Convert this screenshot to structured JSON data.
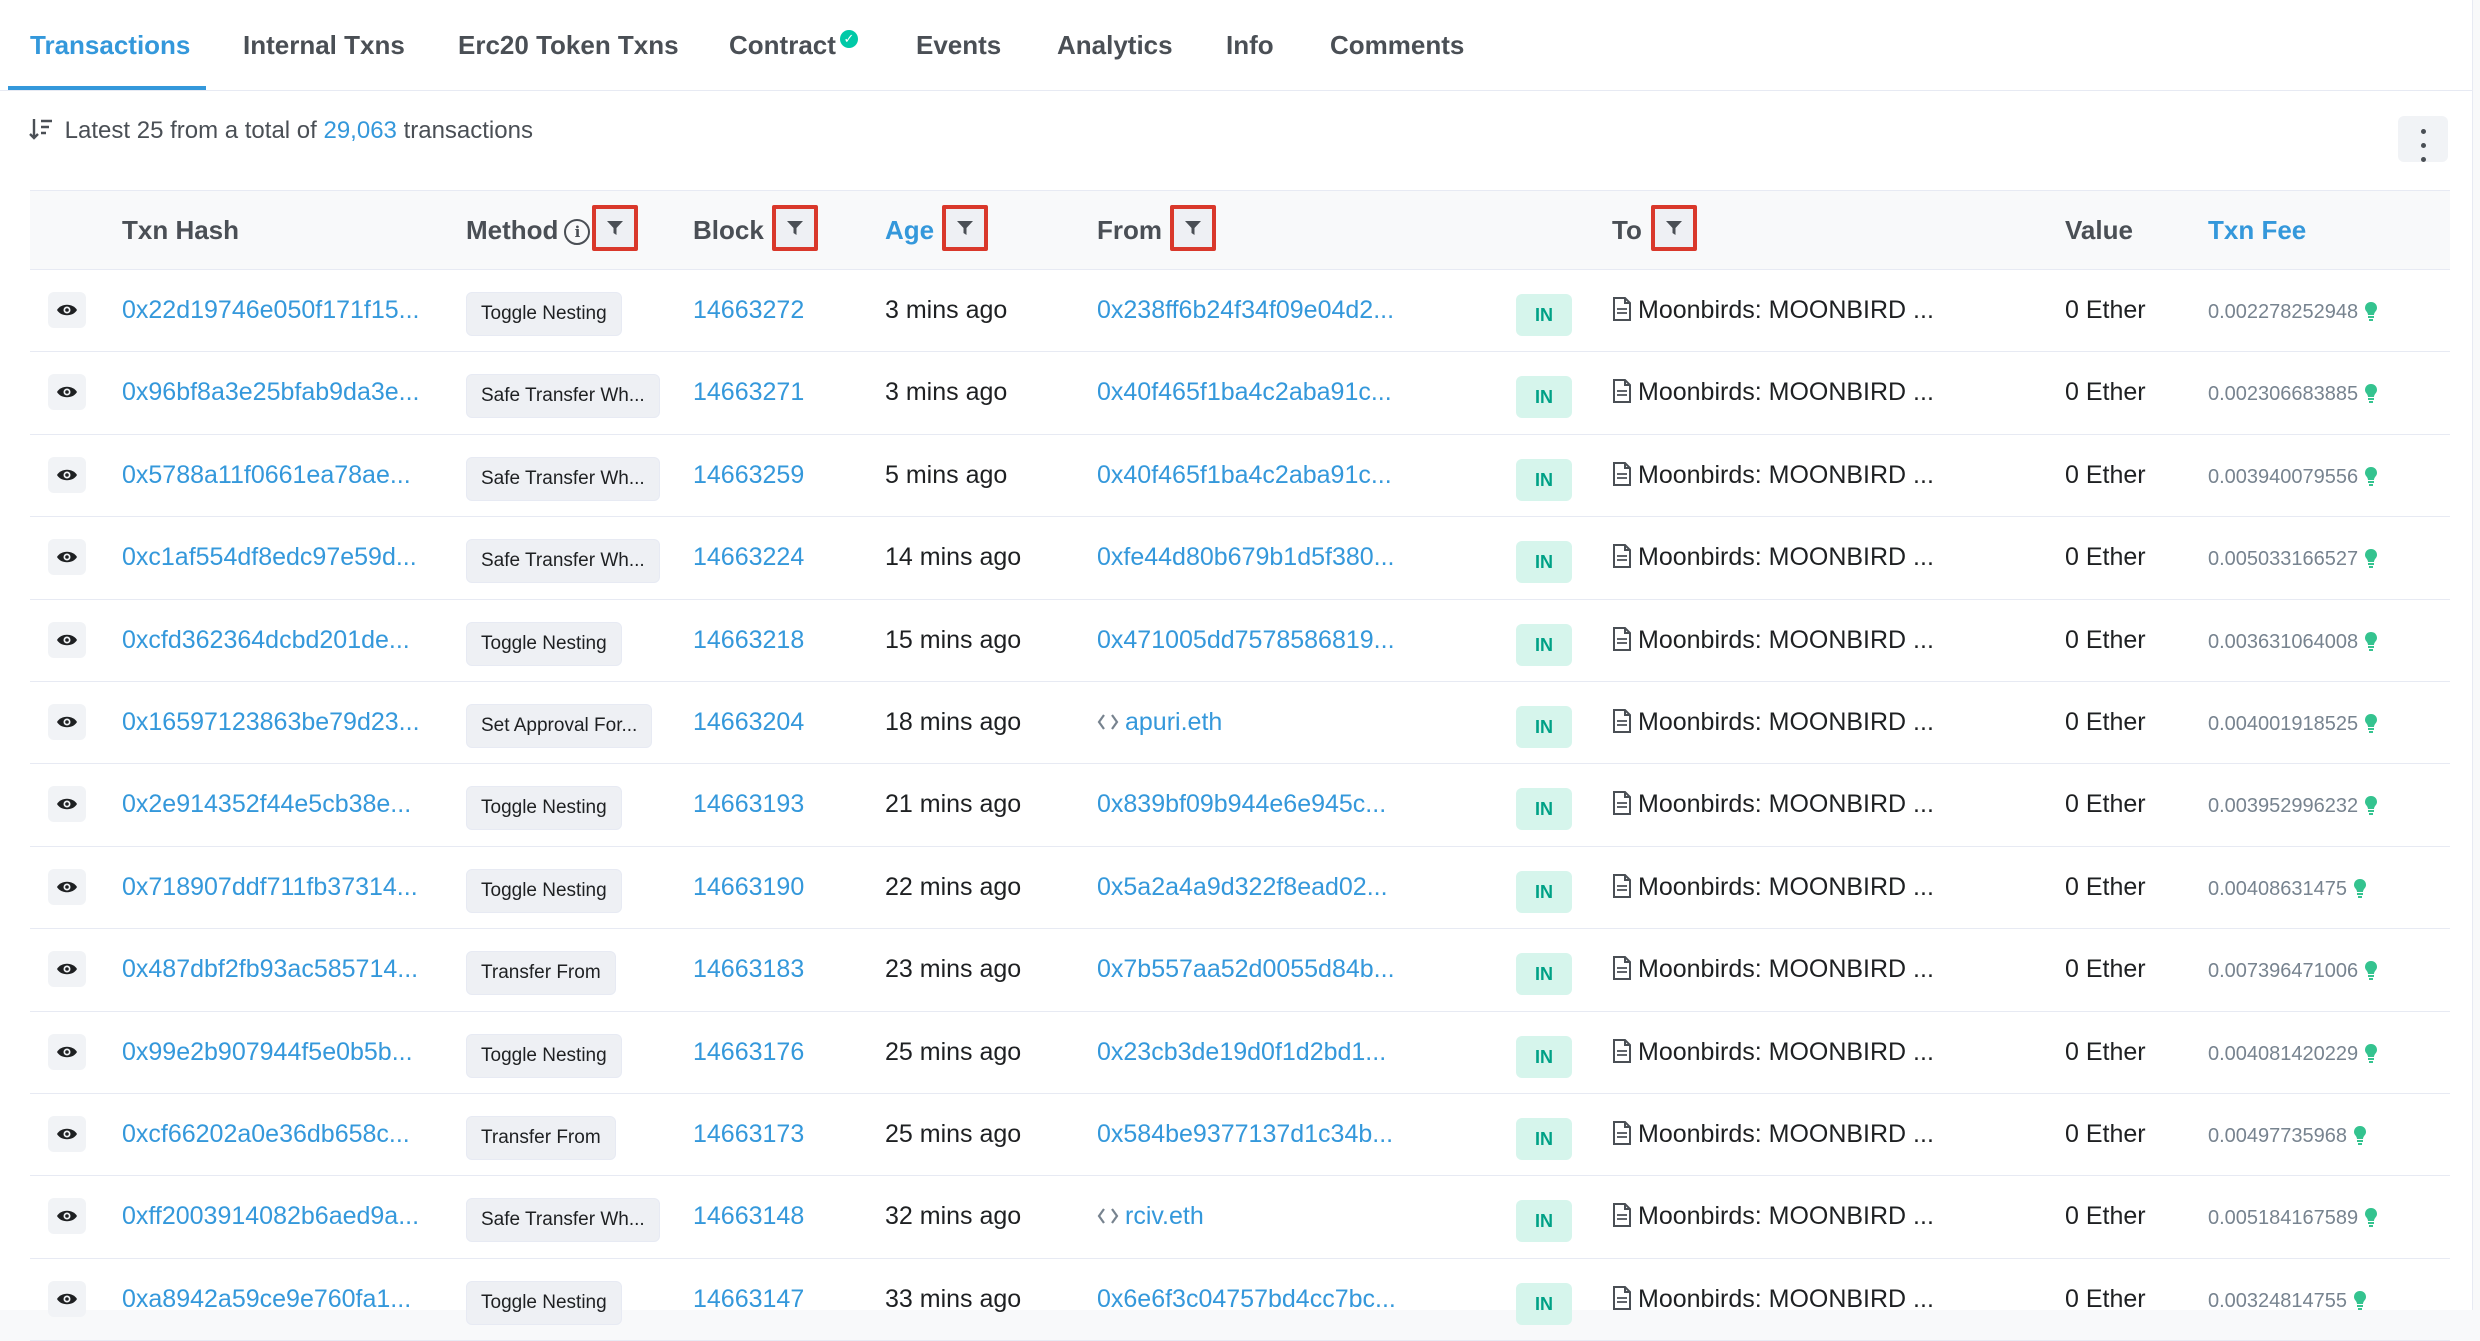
{
  "tabs": [
    {
      "label": "Transactions",
      "active": true
    },
    {
      "label": "Internal Txns"
    },
    {
      "label": "Erc20 Token Txns"
    },
    {
      "label": "Contract",
      "verified": true
    },
    {
      "label": "Events"
    },
    {
      "label": "Analytics"
    },
    {
      "label": "Info"
    },
    {
      "label": "Comments"
    }
  ],
  "summary": {
    "prefix": "Latest 25 from a total of",
    "count": "29,063",
    "suffix": "transactions"
  },
  "columns": {
    "txn_hash": "Txn Hash",
    "method": "Method",
    "block": "Block",
    "age": "Age",
    "from": "From",
    "to": "To",
    "value": "Value",
    "txn_fee": "Txn Fee"
  },
  "colors": {
    "accent": "#3498db",
    "in_badge_bg": "#d6f5ec",
    "in_badge_text": "#00a186",
    "filter_highlight": "#d9382b"
  },
  "rows": [
    {
      "hash": "0x22d19746e050f171f15...",
      "method": "Toggle Nesting",
      "block": "14663272",
      "age": "3 mins ago",
      "from": "0x238ff6b24f34f09e04d2...",
      "from_ens": false,
      "direction": "IN",
      "to": "Moonbirds: MOONBIRD ...",
      "value": "0 Ether",
      "fee": "0.002278252948"
    },
    {
      "hash": "0x96bf8a3e25bfab9da3e...",
      "method": "Safe Transfer Wh...",
      "block": "14663271",
      "age": "3 mins ago",
      "from": "0x40f465f1ba4c2aba91c...",
      "from_ens": false,
      "direction": "IN",
      "to": "Moonbirds: MOONBIRD ...",
      "value": "0 Ether",
      "fee": "0.002306683885"
    },
    {
      "hash": "0x5788a11f0661ea78ae...",
      "method": "Safe Transfer Wh...",
      "block": "14663259",
      "age": "5 mins ago",
      "from": "0x40f465f1ba4c2aba91c...",
      "from_ens": false,
      "direction": "IN",
      "to": "Moonbirds: MOONBIRD ...",
      "value": "0 Ether",
      "fee": "0.003940079556"
    },
    {
      "hash": "0xc1af554df8edc97e59d...",
      "method": "Safe Transfer Wh...",
      "block": "14663224",
      "age": "14 mins ago",
      "from": "0xfe44d80b679b1d5f380...",
      "from_ens": false,
      "direction": "IN",
      "to": "Moonbirds: MOONBIRD ...",
      "value": "0 Ether",
      "fee": "0.005033166527"
    },
    {
      "hash": "0xcfd362364dcbd201de...",
      "method": "Toggle Nesting",
      "block": "14663218",
      "age": "15 mins ago",
      "from": "0x471005dd7578586819...",
      "from_ens": false,
      "direction": "IN",
      "to": "Moonbirds: MOONBIRD ...",
      "value": "0 Ether",
      "fee": "0.003631064008"
    },
    {
      "hash": "0x16597123863be79d23...",
      "method": "Set Approval For...",
      "block": "14663204",
      "age": "18 mins ago",
      "from": "apuri.eth",
      "from_ens": true,
      "direction": "IN",
      "to": "Moonbirds: MOONBIRD ...",
      "value": "0 Ether",
      "fee": "0.004001918525"
    },
    {
      "hash": "0x2e914352f44e5cb38e...",
      "method": "Toggle Nesting",
      "block": "14663193",
      "age": "21 mins ago",
      "from": "0x839bf09b944e6e945c...",
      "from_ens": false,
      "direction": "IN",
      "to": "Moonbirds: MOONBIRD ...",
      "value": "0 Ether",
      "fee": "0.003952996232"
    },
    {
      "hash": "0x718907ddf711fb37314...",
      "method": "Toggle Nesting",
      "block": "14663190",
      "age": "22 mins ago",
      "from": "0x5a2a4a9d322f8ead02...",
      "from_ens": false,
      "direction": "IN",
      "to": "Moonbirds: MOONBIRD ...",
      "value": "0 Ether",
      "fee": "0.00408631475"
    },
    {
      "hash": "0x487dbf2fb93ac585714...",
      "method": "Transfer From",
      "block": "14663183",
      "age": "23 mins ago",
      "from": "0x7b557aa52d0055d84b...",
      "from_ens": false,
      "direction": "IN",
      "to": "Moonbirds: MOONBIRD ...",
      "value": "0 Ether",
      "fee": "0.007396471006"
    },
    {
      "hash": "0x99e2b907944f5e0b5b...",
      "method": "Toggle Nesting",
      "block": "14663176",
      "age": "25 mins ago",
      "from": "0x23cb3de19d0f1d2bd1...",
      "from_ens": false,
      "direction": "IN",
      "to": "Moonbirds: MOONBIRD ...",
      "value": "0 Ether",
      "fee": "0.004081420229"
    },
    {
      "hash": "0xcf66202a0e36db658c...",
      "method": "Transfer From",
      "block": "14663173",
      "age": "25 mins ago",
      "from": "0x584be9377137d1c34b...",
      "from_ens": false,
      "direction": "IN",
      "to": "Moonbirds: MOONBIRD ...",
      "value": "0 Ether",
      "fee": "0.00497735968"
    },
    {
      "hash": "0xff2003914082b6aed9a...",
      "method": "Safe Transfer Wh...",
      "block": "14663148",
      "age": "32 mins ago",
      "from": "rciv.eth",
      "from_ens": true,
      "direction": "IN",
      "to": "Moonbirds: MOONBIRD ...",
      "value": "0 Ether",
      "fee": "0.005184167589"
    },
    {
      "hash": "0xa8942a59ce9e760fa1...",
      "method": "Toggle Nesting",
      "block": "14663147",
      "age": "33 mins ago",
      "from": "0x6e6f3c04757bd4cc7bc...",
      "from_ens": false,
      "direction": "IN",
      "to": "Moonbirds: MOONBIRD ...",
      "value": "0 Ether",
      "fee": "0.00324814755"
    }
  ]
}
